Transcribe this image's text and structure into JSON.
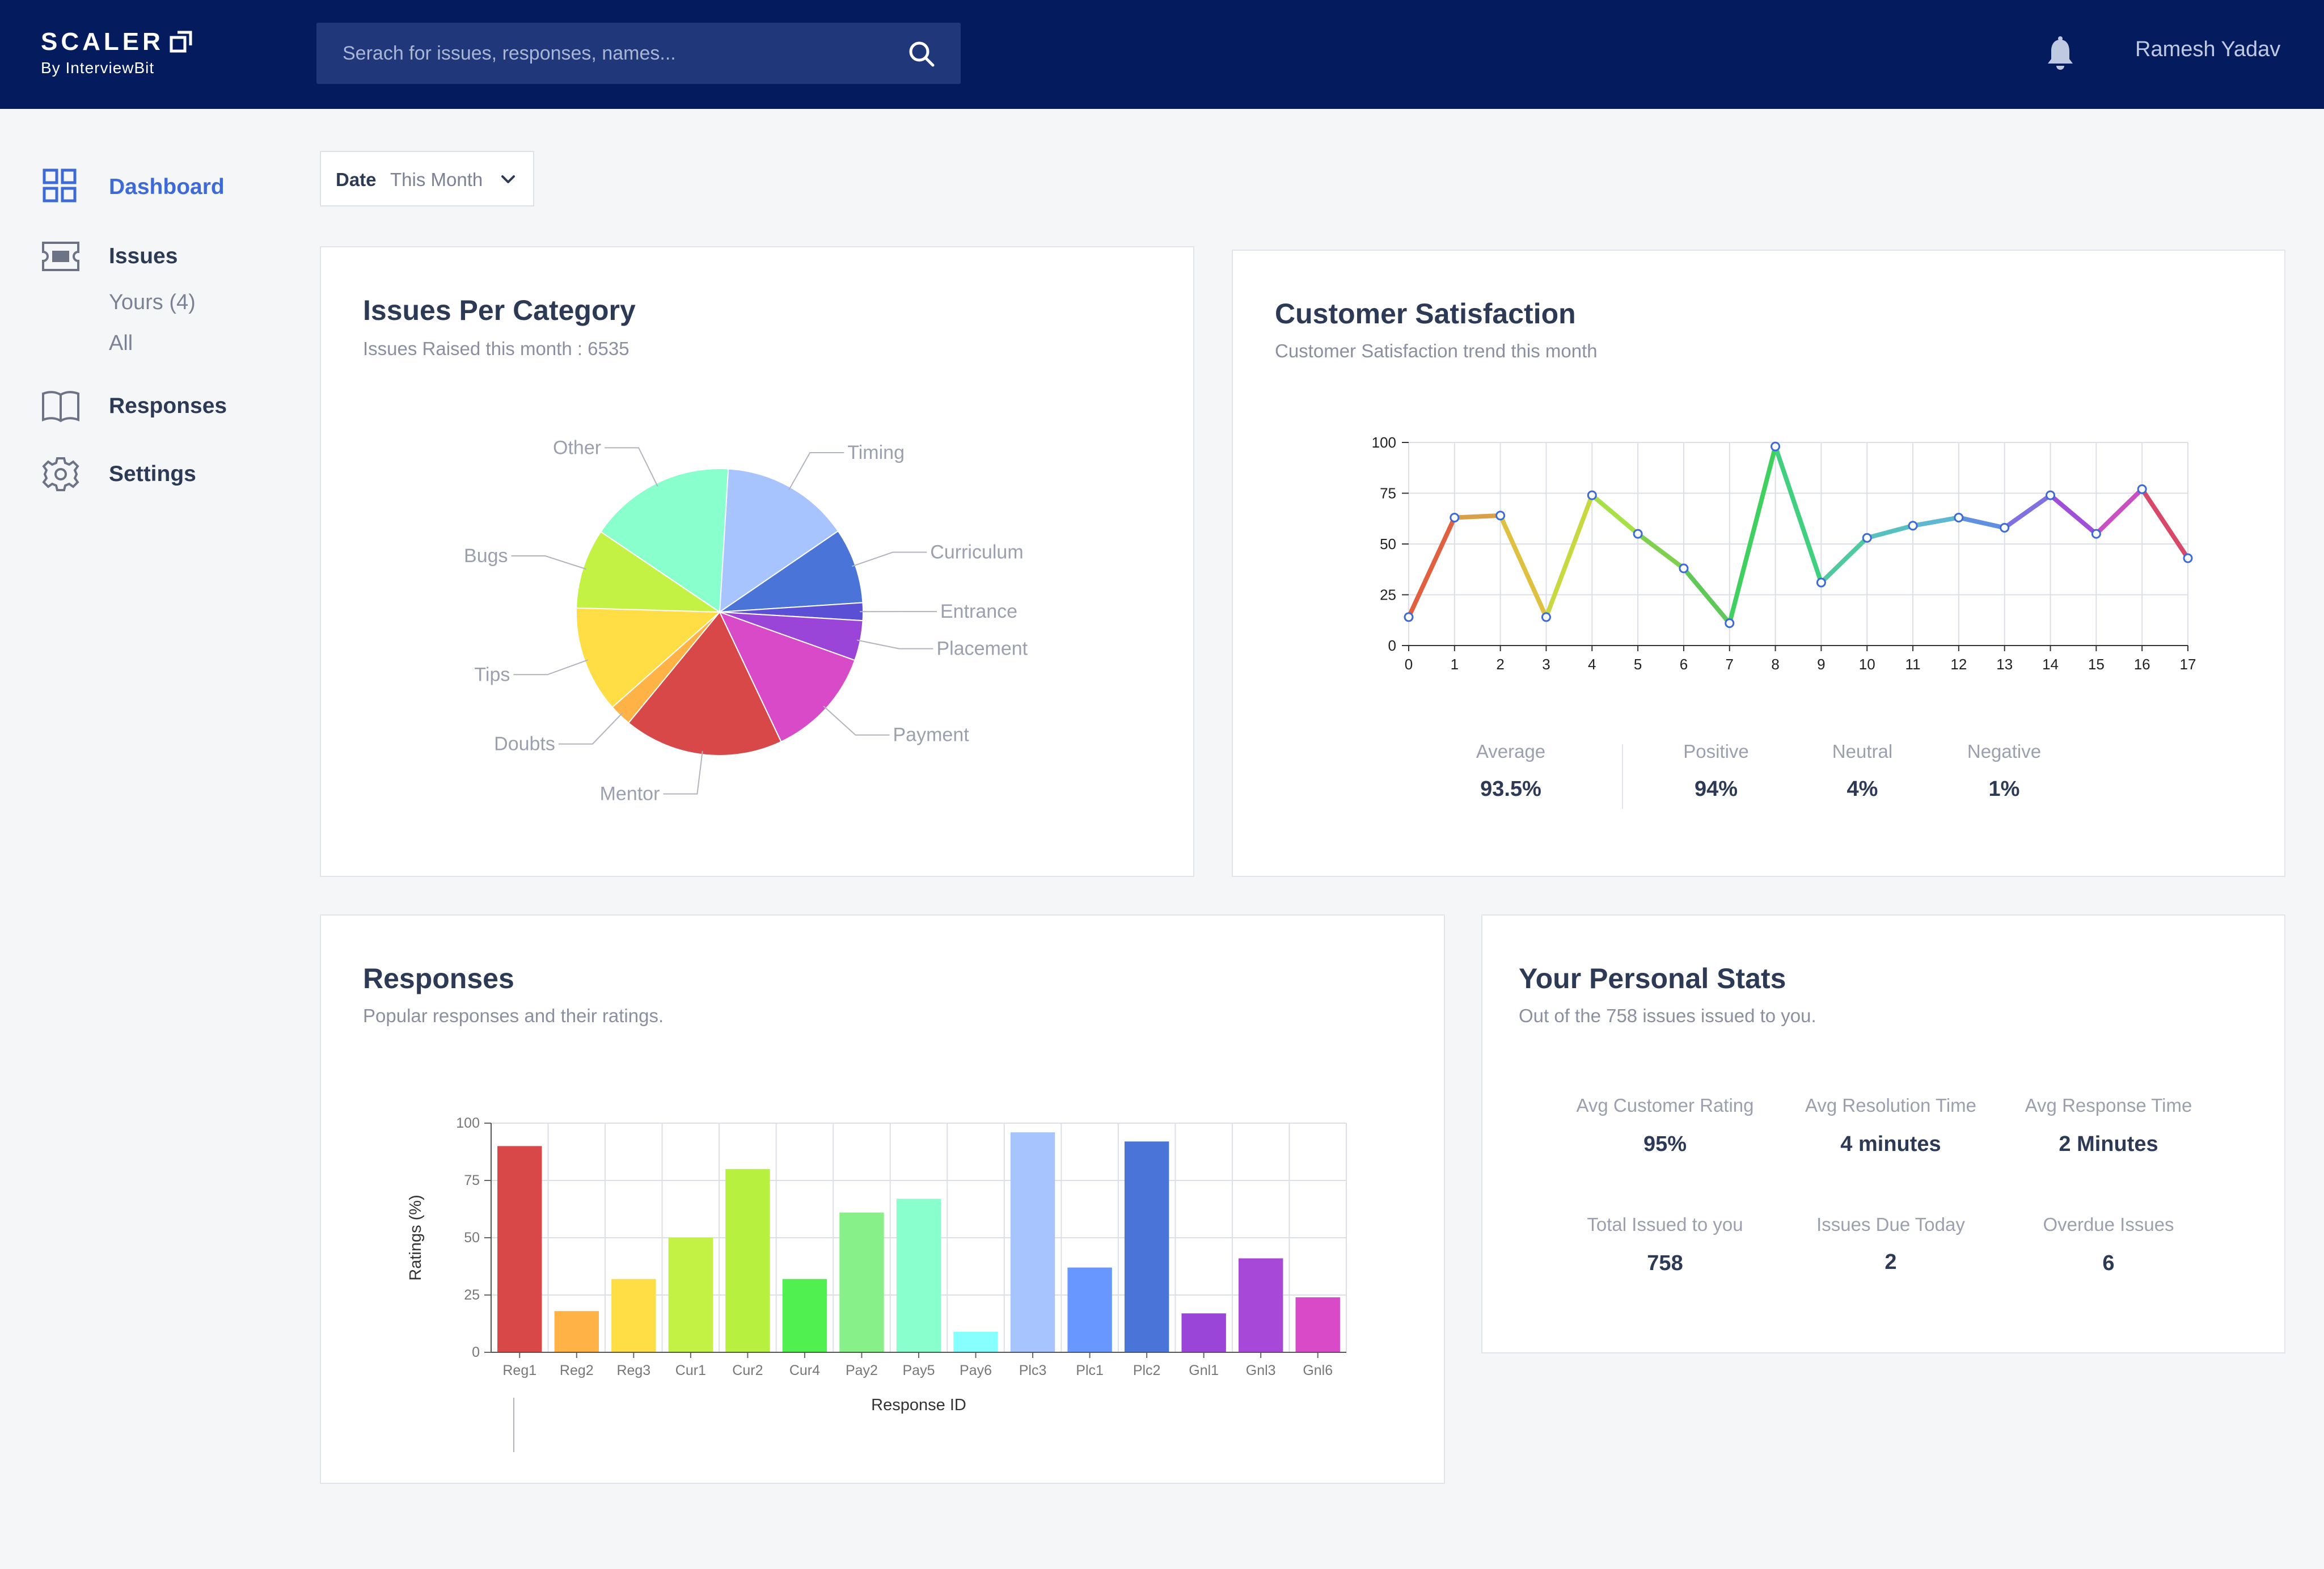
{
  "header": {
    "logo_main": "SCALER",
    "logo_sub": "By InterviewBit",
    "search_placeholder": "Serach for issues, responses, names...",
    "search_icon": "search-icon",
    "bell_icon": "bell-icon",
    "username": "Ramesh Yadav",
    "background_color": "#041c5e"
  },
  "sidebar": {
    "items": [
      {
        "label": "Dashboard",
        "icon": "grid-icon",
        "active": true
      },
      {
        "label": "Issues",
        "icon": "ticket-icon"
      },
      {
        "label": "Responses",
        "icon": "book-icon"
      },
      {
        "label": "Settings",
        "icon": "gear-icon"
      }
    ],
    "issues_sub": [
      "Yours (4)",
      "All"
    ],
    "accent_color": "#3d6ad6"
  },
  "filter": {
    "label": "Date",
    "value": "This Month"
  },
  "issues_card": {
    "title": "Issues Per Category",
    "subtitle": "Issues Raised this month : 6535"
  },
  "satisfaction_card": {
    "title": "Customer Satisfaction",
    "subtitle": "Customer Satisfaction trend this month",
    "stats": [
      {
        "label": "Average",
        "value": "93.5%"
      },
      {
        "label": "Positive",
        "value": "94%"
      },
      {
        "label": "Neutral",
        "value": "4%"
      },
      {
        "label": "Negative",
        "value": "1%"
      }
    ]
  },
  "responses_card": {
    "title": "Responses",
    "subtitle": "Popular responses and their ratings."
  },
  "personal_card": {
    "title": "Your Personal Stats",
    "subtitle": "Out of the 758 issues issued to you.",
    "stats": [
      {
        "label": "Avg Customer Rating",
        "value": "95%"
      },
      {
        "label": "Avg Resolution Time",
        "value": "4 minutes"
      },
      {
        "label": "Avg Response Time",
        "value": "2 Minutes"
      },
      {
        "label": "Total Issued to you",
        "value": "758"
      },
      {
        "label": "Issues Due Today",
        "value": "2"
      },
      {
        "label": "Overdue Issues",
        "value": "6"
      }
    ]
  },
  "chart_data": [
    {
      "type": "pie",
      "title": "Issues Per Category",
      "slices": [
        {
          "label": "Timing",
          "value": 14.5,
          "color": "#a8c4ff"
        },
        {
          "label": "Curriculum",
          "value": 8.5,
          "color": "#4a74d8"
        },
        {
          "label": "Entrance",
          "value": 2,
          "color": "#5b4fd6"
        },
        {
          "label": "Placement",
          "value": 4.5,
          "color": "#9b44d8"
        },
        {
          "label": "Payment",
          "value": 12.5,
          "color": "#d84ac8"
        },
        {
          "label": "Mentor",
          "value": 18,
          "color": "#d84848"
        },
        {
          "label": "Doubts",
          "value": 2.5,
          "color": "#ffb347"
        },
        {
          "label": "Tips",
          "value": 12,
          "color": "#ffdd44"
        },
        {
          "label": "Bugs",
          "value": 9,
          "color": "#c4f244"
        },
        {
          "label": "Other",
          "value": 16.5,
          "color": "#88ffcc"
        }
      ]
    },
    {
      "type": "line",
      "title": "",
      "x": [
        0,
        1,
        2,
        3,
        4,
        5,
        6,
        7,
        8,
        9,
        10,
        11,
        12,
        13,
        14,
        15,
        16,
        17
      ],
      "y": [
        14,
        63,
        64,
        14,
        74,
        55,
        38,
        11,
        98,
        31,
        53,
        59,
        63,
        58,
        74,
        55,
        77,
        43
      ],
      "xlim": [
        0,
        17
      ],
      "ylim": [
        0,
        100
      ],
      "yticks": [
        0,
        25,
        50,
        75,
        100
      ],
      "colors": [
        "#e06040",
        "#d8a048",
        "#e0c040",
        "#c8d840",
        "#a8e048",
        "#80d050",
        "#60c858",
        "#40d060",
        "#40d080",
        "#50c8a0",
        "#58c0c0",
        "#60b8d0",
        "#6090e0",
        "#8070e0",
        "#a050d8",
        "#c850c0",
        "#d84868"
      ],
      "grid": true
    },
    {
      "type": "bar",
      "title": "",
      "xlabel": "Response ID",
      "ylabel": "Ratings (%)",
      "ylim": [
        0,
        100
      ],
      "yticks": [
        0,
        25,
        50,
        75,
        100
      ],
      "categories": [
        "Reg1",
        "Reg2",
        "Reg3",
        "Cur1",
        "Cur2",
        "Cur4",
        "Pay2",
        "Pay5",
        "Pay6",
        "Plc3",
        "Plc1",
        "Plc2",
        "Gnl1",
        "Gnl3",
        "Gnl6"
      ],
      "values": [
        90,
        18,
        32,
        50,
        80,
        32,
        61,
        67,
        9,
        96,
        37,
        92,
        17,
        41,
        24
      ],
      "colors": [
        "#d84848",
        "#ffb347",
        "#ffdd44",
        "#c4f244",
        "#b8f040",
        "#50f050",
        "#88f088",
        "#88ffcc",
        "#88ffff",
        "#a8c4ff",
        "#6898ff",
        "#4a74d8",
        "#9b44d8",
        "#a848d8",
        "#d84ac8"
      ],
      "grid": true
    }
  ]
}
